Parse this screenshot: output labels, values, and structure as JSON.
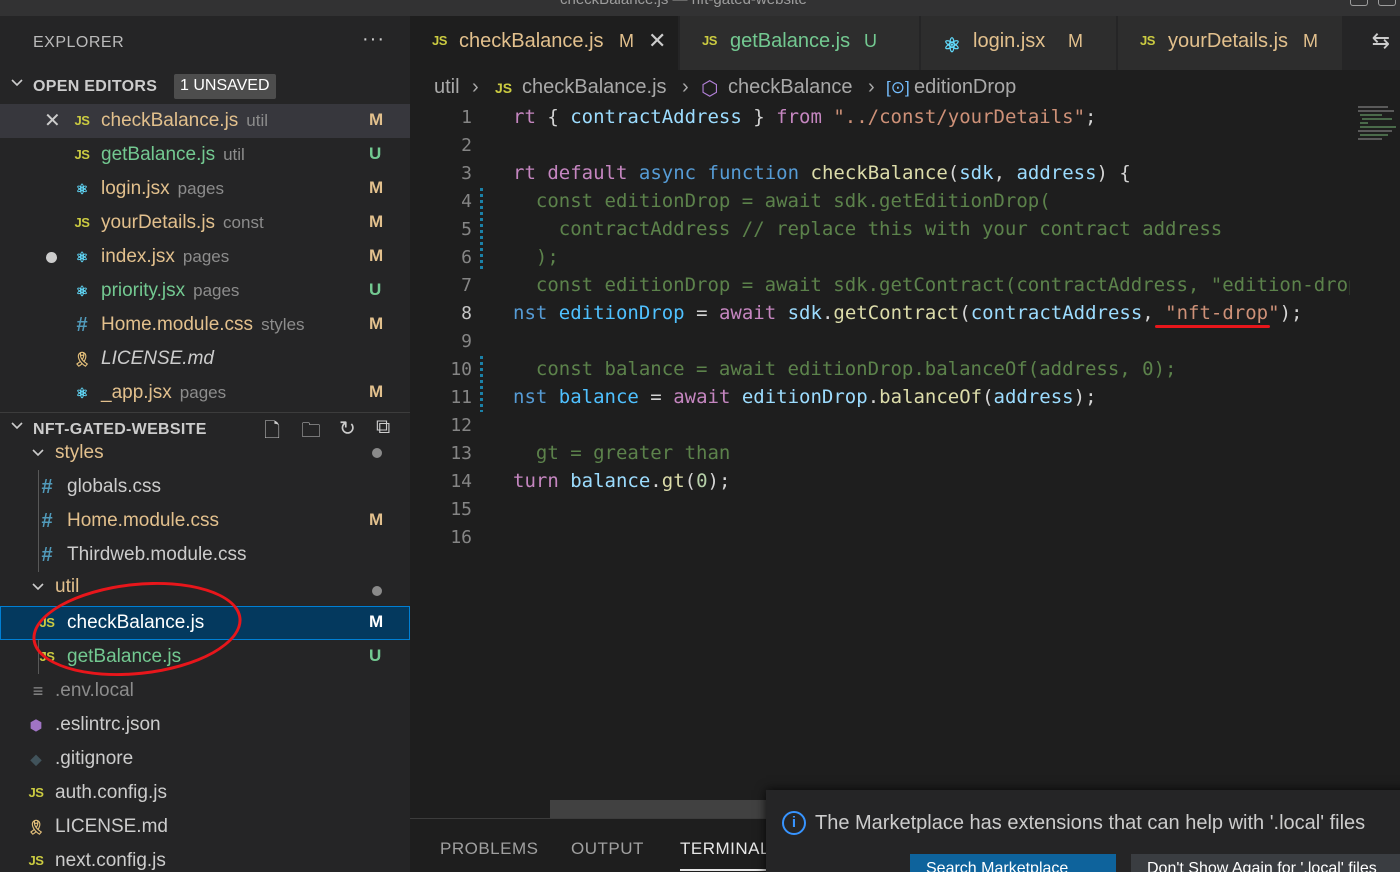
{
  "window": {
    "title": "checkBalance.js — nft-gated-website"
  },
  "explorer": {
    "title": "EXPLORER",
    "more": "···",
    "open_editors": {
      "label": "OPEN EDITORS",
      "badge": "1 UNSAVED",
      "items": [
        {
          "name": "checkBalance.js",
          "desc": "util",
          "status": "M",
          "icon": "js-icon",
          "icon_glyph": "JS"
        },
        {
          "name": "getBalance.js",
          "desc": "util",
          "status": "U",
          "icon": "js-icon",
          "icon_glyph": "JS"
        },
        {
          "name": "login.jsx",
          "desc": "pages",
          "status": "M",
          "icon": "react-icon",
          "icon_glyph": "⚛"
        },
        {
          "name": "yourDetails.js",
          "desc": "const",
          "status": "M",
          "icon": "js-icon",
          "icon_glyph": "JS"
        },
        {
          "name": "index.jsx",
          "desc": "pages",
          "status": "M",
          "icon": "react-icon",
          "icon_glyph": "⚛"
        },
        {
          "name": "priority.jsx",
          "desc": "pages",
          "status": "U",
          "icon": "react-icon",
          "icon_glyph": "⚛"
        },
        {
          "name": "Home.module.css",
          "desc": "styles",
          "status": "M",
          "icon": "css-icon",
          "icon_glyph": "#"
        },
        {
          "name": "LICENSE.md",
          "desc": "",
          "status": "",
          "icon": "license-icon",
          "icon_glyph": "🎗"
        },
        {
          "name": "_app.jsx",
          "desc": "pages",
          "status": "M",
          "icon": "react-icon",
          "icon_glyph": "⚛"
        }
      ]
    },
    "project": {
      "label": "NFT-GATED-WEBSITE",
      "actions": [
        "new-file-icon",
        "new-folder-icon",
        "refresh-icon",
        "collapse-all-icon"
      ],
      "tree": [
        {
          "name": "styles",
          "type": "folder"
        },
        {
          "name": "globals.css",
          "status": ""
        },
        {
          "name": "Home.module.css",
          "status": "M"
        },
        {
          "name": "Thirdweb.module.css",
          "status": ""
        },
        {
          "name": "util",
          "type": "folder"
        },
        {
          "name": "checkBalance.js",
          "status": "M"
        },
        {
          "name": "getBalance.js",
          "status": "U"
        },
        {
          "name": ".env.local",
          "status": ""
        },
        {
          "name": ".eslintrc.json",
          "status": ""
        },
        {
          "name": ".gitignore",
          "status": ""
        },
        {
          "name": "auth.config.js",
          "status": ""
        },
        {
          "name": "LICENSE.md",
          "status": ""
        },
        {
          "name": "next.config.js",
          "status": ""
        }
      ]
    }
  },
  "tabs": [
    {
      "label": "checkBalance.js",
      "status": "M",
      "icon_glyph": "JS",
      "active": true
    },
    {
      "label": "getBalance.js",
      "status": "U",
      "icon_glyph": "JS"
    },
    {
      "label": "login.jsx",
      "status": "M",
      "icon_glyph": "⚛"
    },
    {
      "label": "yourDetails.js",
      "status": "M",
      "icon_glyph": "JS"
    }
  ],
  "breadcrumb": [
    "util",
    "checkBalance.js",
    "checkBalance",
    "editionDrop"
  ],
  "code": {
    "line_numbers": [
      "1",
      "2",
      "3",
      "4",
      "5",
      "6",
      "7",
      "8",
      "9",
      "10",
      "11",
      "12",
      "13",
      "14",
      "15",
      "16"
    ],
    "current_line": 8
  },
  "panel": {
    "tabs": [
      "PROBLEMS",
      "OUTPUT",
      "TERMINAL"
    ],
    "active": "TERMINAL"
  },
  "notification": {
    "message": "The Marketplace has extensions that can help with '.local' files",
    "primary_button": "Search Marketplace",
    "secondary_button": "Don't Show Again for '.local' files"
  },
  "colors": {
    "modified": "#e2c08d",
    "untracked": "#73c991",
    "annotation": "#e8161b",
    "selection": "#04395e"
  }
}
